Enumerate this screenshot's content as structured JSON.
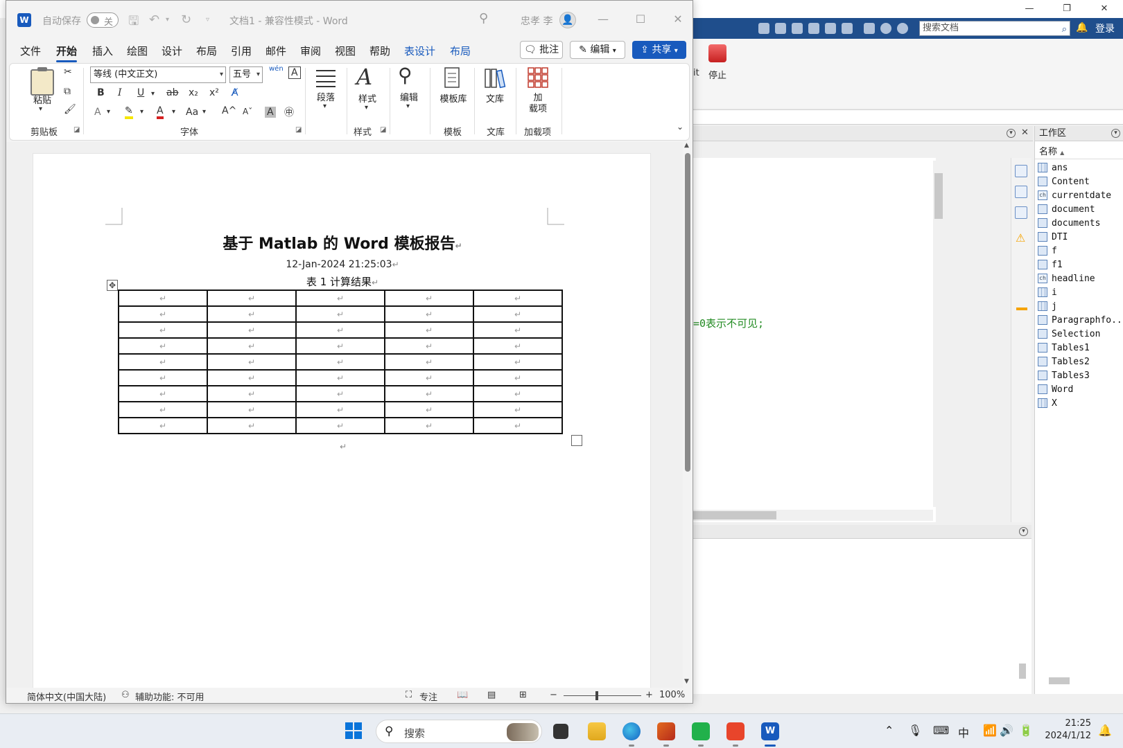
{
  "matlab": {
    "window_controls": {
      "minimize": "—",
      "restore": "❐",
      "close": "✕"
    },
    "search_placeholder": "搜索文档",
    "login": "登录",
    "ribbon": {
      "cut_partial": "it",
      "stop": "停止"
    },
    "code_fragment": "=0表示不可见;",
    "workspace": {
      "title": "工作区",
      "column_name": "名称",
      "sort_indicator": "▲",
      "variables": [
        {
          "name": "ans",
          "icon": "matrix"
        },
        {
          "name": "Content",
          "icon": "object"
        },
        {
          "name": "currentdate",
          "icon": "char"
        },
        {
          "name": "document",
          "icon": "object"
        },
        {
          "name": "documents",
          "icon": "object"
        },
        {
          "name": "DTI",
          "icon": "object"
        },
        {
          "name": "f",
          "icon": "object"
        },
        {
          "name": "f1",
          "icon": "object"
        },
        {
          "name": "headline",
          "icon": "char"
        },
        {
          "name": "i",
          "icon": "matrix"
        },
        {
          "name": "j",
          "icon": "matrix"
        },
        {
          "name": "Paragraphfo...",
          "icon": "object"
        },
        {
          "name": "Selection",
          "icon": "object"
        },
        {
          "name": "Tables1",
          "icon": "object"
        },
        {
          "name": "Tables2",
          "icon": "object"
        },
        {
          "name": "Tables3",
          "icon": "object"
        },
        {
          "name": "Word",
          "icon": "object"
        },
        {
          "name": "X",
          "icon": "matrix"
        }
      ]
    }
  },
  "word": {
    "logo": "W",
    "autosave_label": "自动保存",
    "autosave_state": "关",
    "doc_title": "文档1 - 兼容性模式 - Word",
    "user_name": "忠孝 李",
    "tabs": {
      "file": "文件",
      "home": "开始",
      "insert": "插入",
      "draw": "绘图",
      "design": "设计",
      "layout": "布局",
      "references": "引用",
      "mailings": "邮件",
      "review": "审阅",
      "view": "视图",
      "help": "帮助",
      "table_design": "表设计",
      "table_layout": "布局"
    },
    "comment_btn": "批注",
    "edit_btn": "编辑",
    "share_btn": "共享",
    "ribbon": {
      "paste": "粘贴",
      "clipboard": "剪贴板",
      "font_name": "等线 (中文正文)",
      "font_size": "五号",
      "font": "字体",
      "paragraph": "段落",
      "styles_btn": "样式",
      "styles": "样式",
      "editing": "编辑",
      "templates_btn": "模板库",
      "templates": "模板",
      "library_btn": "文库",
      "library": "文库",
      "addins_btn_line1": "加",
      "addins_btn_line2": "载项",
      "addins": "加载项",
      "bold": "B",
      "italic": "I",
      "underline": "U",
      "strike": "ab",
      "subscript": "x₂",
      "superscript": "x²",
      "change_case": "Aa",
      "grow": "A^",
      "shrink": "Aˇ"
    },
    "document": {
      "title": "基于 Matlab 的 Word 模板报告",
      "date": "12-Jan-2024 21:25:03",
      "caption": "表 1 计算结果",
      "para_mark": "↵",
      "table": {
        "rows": 9,
        "cols": 5
      }
    },
    "status": {
      "language": "简体中文(中国大陆)",
      "accessibility": "辅助功能: 不可用",
      "focus": "专注",
      "zoom": "100%"
    }
  },
  "taskbar": {
    "search": "搜索",
    "tray": {
      "ime": "中"
    },
    "time": "21:25",
    "date": "2024/1/12"
  },
  "colors": {
    "word_blue": "#185abd",
    "matlab_toolbar": "#1f4e8c",
    "code_green": "#228b22"
  }
}
